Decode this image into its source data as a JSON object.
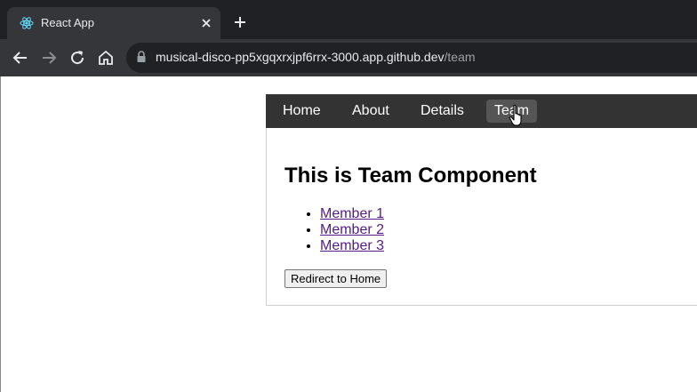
{
  "browser": {
    "tab": {
      "title": "React App",
      "favicon": "react-logo-icon"
    },
    "address": {
      "host": "musical-disco-pp5xgqxrxjpf6rrx-3000.app.github.dev",
      "path": "/team"
    },
    "icons": [
      "back-icon",
      "forward-icon",
      "reload-icon",
      "home-icon",
      "lock-icon",
      "close-icon",
      "plus-icon"
    ]
  },
  "nav": {
    "items": [
      {
        "label": "Home"
      },
      {
        "label": "About"
      },
      {
        "label": "Details"
      },
      {
        "label": "Team",
        "active": true
      }
    ]
  },
  "main": {
    "heading": "This is Team Component",
    "members": [
      "Member 1",
      "Member 2",
      "Member 3"
    ],
    "redirect_label": "Redirect to Home"
  },
  "colors": {
    "chrome_dark": "#202124",
    "chrome_toolbar": "#35363a",
    "nav_bg": "#333333",
    "nav_active": "#555555",
    "visited_link": "#551a8b"
  }
}
